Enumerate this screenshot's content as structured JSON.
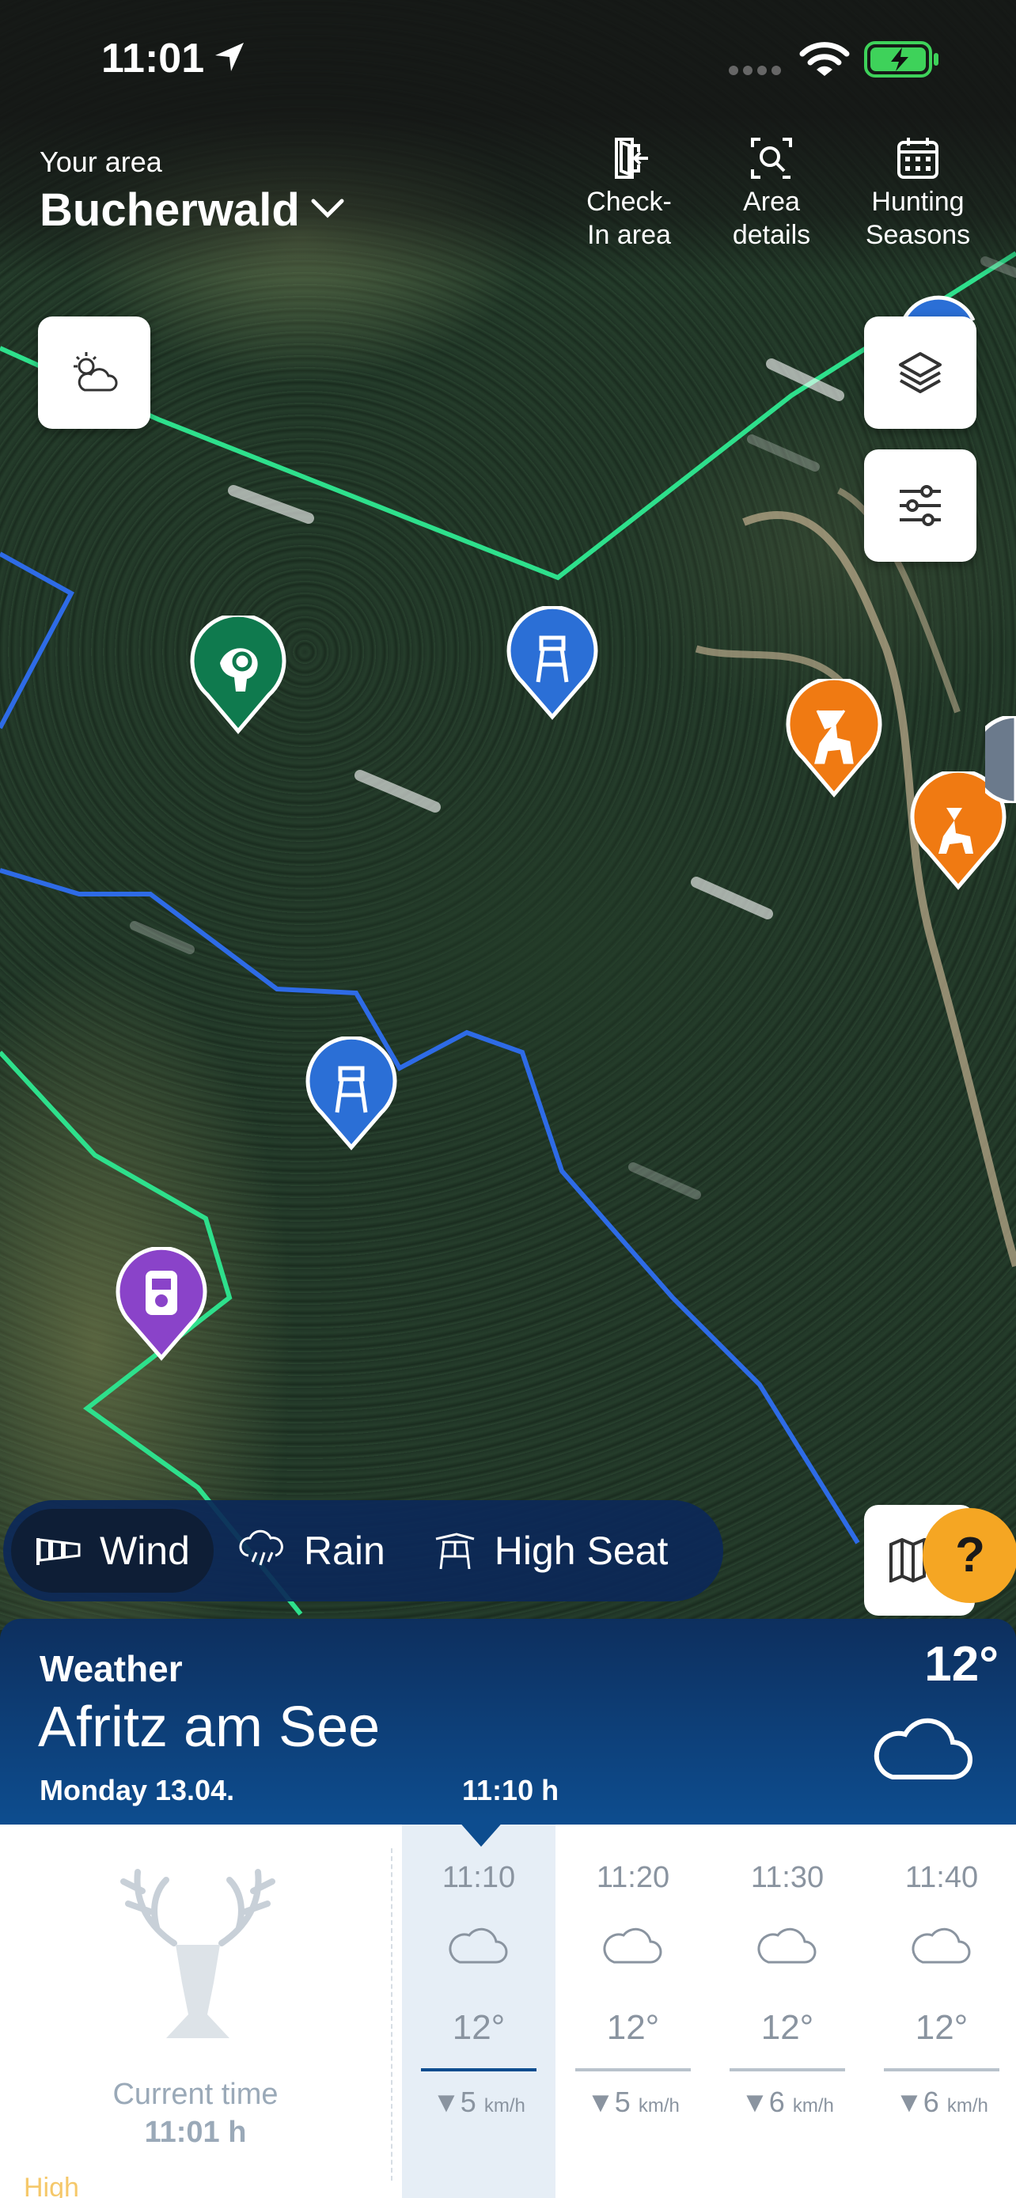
{
  "status_bar": {
    "time": "11:01"
  },
  "header": {
    "area_caption": "Your area",
    "area_name": "Bucherwald",
    "buttons": [
      {
        "id": "checkin",
        "label": "Check-\nIn area",
        "icon": "door-enter-icon"
      },
      {
        "id": "details",
        "label": "Area\ndetails",
        "icon": "search-frame-icon"
      },
      {
        "id": "seasons",
        "label": "Hunting\nSeasons",
        "icon": "calendar-icon"
      }
    ]
  },
  "map": {
    "boundary_colors": {
      "green": "#2ee08c",
      "blue": "#2e6be6"
    },
    "pin_colors": {
      "blue": "#2b6fd6",
      "green": "#0f7a4e",
      "orange": "#f07a12",
      "purple": "#8a43c9"
    }
  },
  "layers": {
    "options": [
      {
        "id": "wind",
        "label": "Wind",
        "icon": "windsock-icon",
        "active": true
      },
      {
        "id": "rain",
        "label": "Rain",
        "icon": "rain-icon",
        "active": false
      },
      {
        "id": "seat",
        "label": "High Seat",
        "icon": "high-seat-icon",
        "active": false
      }
    ]
  },
  "help": {
    "label": "?"
  },
  "weather": {
    "title": "Weather",
    "place": "Afritz am See",
    "date": "Monday 13.04.",
    "selected_time": "11:10 h",
    "temperature": "12°",
    "current_caption": "Current time",
    "current_time": "11:01 h",
    "tide_label": "High",
    "slots": [
      {
        "time": "11:10",
        "temp": "12°",
        "wind": "5",
        "unit": "km/h",
        "selected": true
      },
      {
        "time": "11:20",
        "temp": "12°",
        "wind": "5",
        "unit": "km/h",
        "selected": false
      },
      {
        "time": "11:30",
        "temp": "12°",
        "wind": "6",
        "unit": "km/h",
        "selected": false
      },
      {
        "time": "11:40",
        "temp": "12°",
        "wind": "6",
        "unit": "km/h",
        "selected": false
      }
    ]
  }
}
